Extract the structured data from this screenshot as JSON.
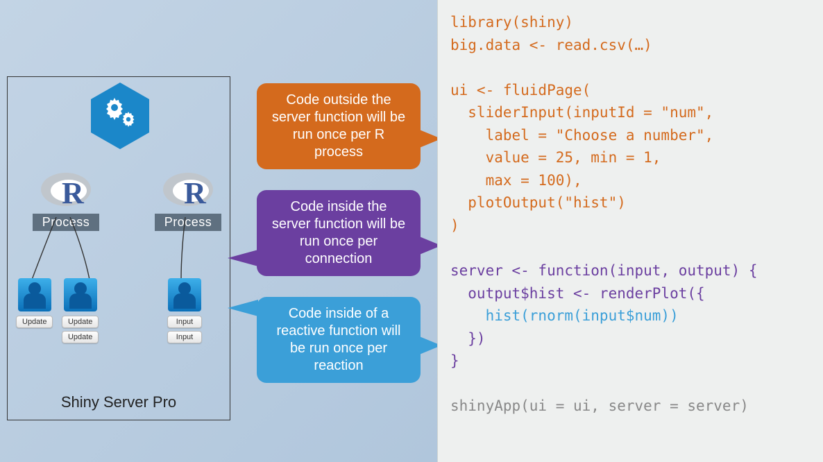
{
  "server_box": {
    "title": "Shiny Server Pro",
    "process_label": "Process",
    "left_users": [
      {
        "buttons": [
          "Update"
        ]
      },
      {
        "buttons": [
          "Update",
          "Update"
        ]
      }
    ],
    "right_users": [
      {
        "buttons": [
          "Input",
          "Input"
        ]
      }
    ]
  },
  "callouts": {
    "orange": "Code outside the server function will be run once per R process",
    "purple": "Code inside the server function will be run once per connection",
    "blue": "Code inside of a reactive function will be run once per reaction"
  },
  "code": {
    "l01": "library(shiny)",
    "l02": "big.data <- read.csv(…)",
    "l03": "",
    "l04": "ui <- fluidPage(",
    "l05": "  sliderInput(inputId = \"num\",",
    "l06": "    label = \"Choose a number\",",
    "l07": "    value = 25, min = 1,",
    "l08": "    max = 100),",
    "l09": "  plotOutput(\"hist\")",
    "l10": ")",
    "l11": "",
    "l12": "server <- function(input, output) {",
    "l13": "  output$hist <- renderPlot({",
    "l14": "    hist(rnorm(input$num))",
    "l15": "  })",
    "l16": "}",
    "l17": "",
    "l18": "shinyApp(ui = ui, server = server)"
  },
  "colors": {
    "orange": "#d46a1d",
    "purple": "#6b3fa0",
    "blue": "#3b9fd8",
    "grey": "#9aa19d"
  }
}
